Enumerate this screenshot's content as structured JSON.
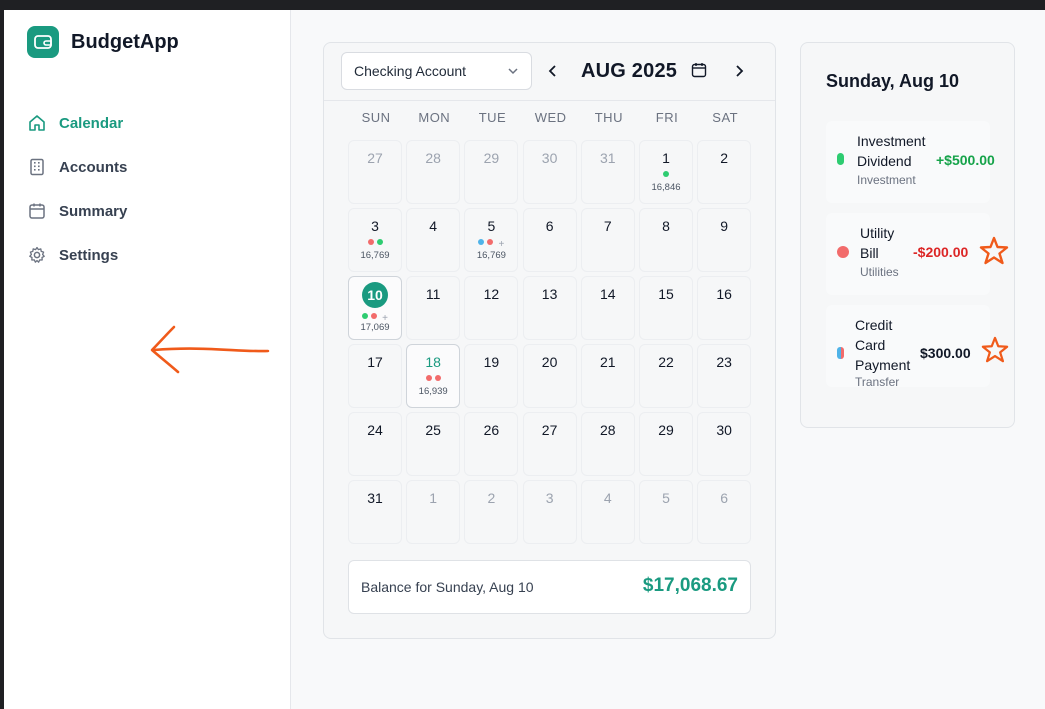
{
  "app": {
    "name": "BudgetApp"
  },
  "nav": [
    {
      "label": "Calendar",
      "icon": "home-icon",
      "active": true
    },
    {
      "label": "Accounts",
      "icon": "building-icon",
      "active": false
    },
    {
      "label": "Summary",
      "icon": "calendar-icon",
      "active": false
    },
    {
      "label": "Settings",
      "icon": "gear-icon",
      "active": false
    }
  ],
  "calendar": {
    "account": "Checking Account",
    "month_label": "AUG 2025",
    "weekdays": [
      "SUN",
      "MON",
      "TUE",
      "WED",
      "THU",
      "FRI",
      "SAT"
    ],
    "days": [
      {
        "d": "27",
        "muted": true
      },
      {
        "d": "28",
        "muted": true
      },
      {
        "d": "29",
        "muted": true
      },
      {
        "d": "30",
        "muted": true
      },
      {
        "d": "31",
        "muted": true
      },
      {
        "d": "1",
        "dots": [
          "#2ecc71"
        ],
        "bal": "16,846"
      },
      {
        "d": "2"
      },
      {
        "d": "3",
        "dots": [
          "#f26b6b",
          "#2ecc71"
        ],
        "bal": "16,769"
      },
      {
        "d": "4"
      },
      {
        "d": "5",
        "dots": [
          "#4fb3e8",
          "#f26b6b"
        ],
        "plus": true,
        "bal": "16,769"
      },
      {
        "d": "6"
      },
      {
        "d": "7"
      },
      {
        "d": "8"
      },
      {
        "d": "9"
      },
      {
        "d": "10",
        "today": true,
        "dots": [
          "#2ecc71",
          "#f26b6b"
        ],
        "plus": true,
        "bal": "17,069",
        "boxed": true
      },
      {
        "d": "11"
      },
      {
        "d": "12"
      },
      {
        "d": "13"
      },
      {
        "d": "14"
      },
      {
        "d": "15"
      },
      {
        "d": "16"
      },
      {
        "d": "17"
      },
      {
        "d": "18",
        "green": true,
        "dots": [
          "#f26b6b",
          "#f26b6b"
        ],
        "bal": "16,939",
        "boxed": true
      },
      {
        "d": "19"
      },
      {
        "d": "20"
      },
      {
        "d": "21"
      },
      {
        "d": "22"
      },
      {
        "d": "23"
      },
      {
        "d": "24"
      },
      {
        "d": "25"
      },
      {
        "d": "26"
      },
      {
        "d": "27"
      },
      {
        "d": "28"
      },
      {
        "d": "29"
      },
      {
        "d": "30"
      },
      {
        "d": "31"
      },
      {
        "d": "1",
        "muted": true
      },
      {
        "d": "2",
        "muted": true
      },
      {
        "d": "3",
        "muted": true
      },
      {
        "d": "4",
        "muted": true
      },
      {
        "d": "5",
        "muted": true
      },
      {
        "d": "6",
        "muted": true
      }
    ],
    "balance_label": "Balance for Sunday, Aug 10",
    "balance_value": "$17,068.67"
  },
  "day_panel": {
    "title": "Sunday, Aug 10",
    "transactions": [
      {
        "name_lines": [
          "Investment",
          "Dividend"
        ],
        "category": "Investment",
        "amount": "+$500.00",
        "color": "#2ecc71",
        "amount_color": "#16a34a",
        "starred": false
      },
      {
        "name_lines": [
          "Utility",
          "Bill"
        ],
        "category": "Utilities",
        "amount": "-$200.00",
        "color": "#f26b6b",
        "amount_color": "#dc2626",
        "starred": true
      },
      {
        "name_lines": [
          "Credit",
          "Card",
          "Payment"
        ],
        "category": "Transfer",
        "amount": "$300.00",
        "color": "#f26b6b",
        "color2": "#4fb3e8",
        "amount_color": "#111827",
        "starred": true
      }
    ]
  }
}
